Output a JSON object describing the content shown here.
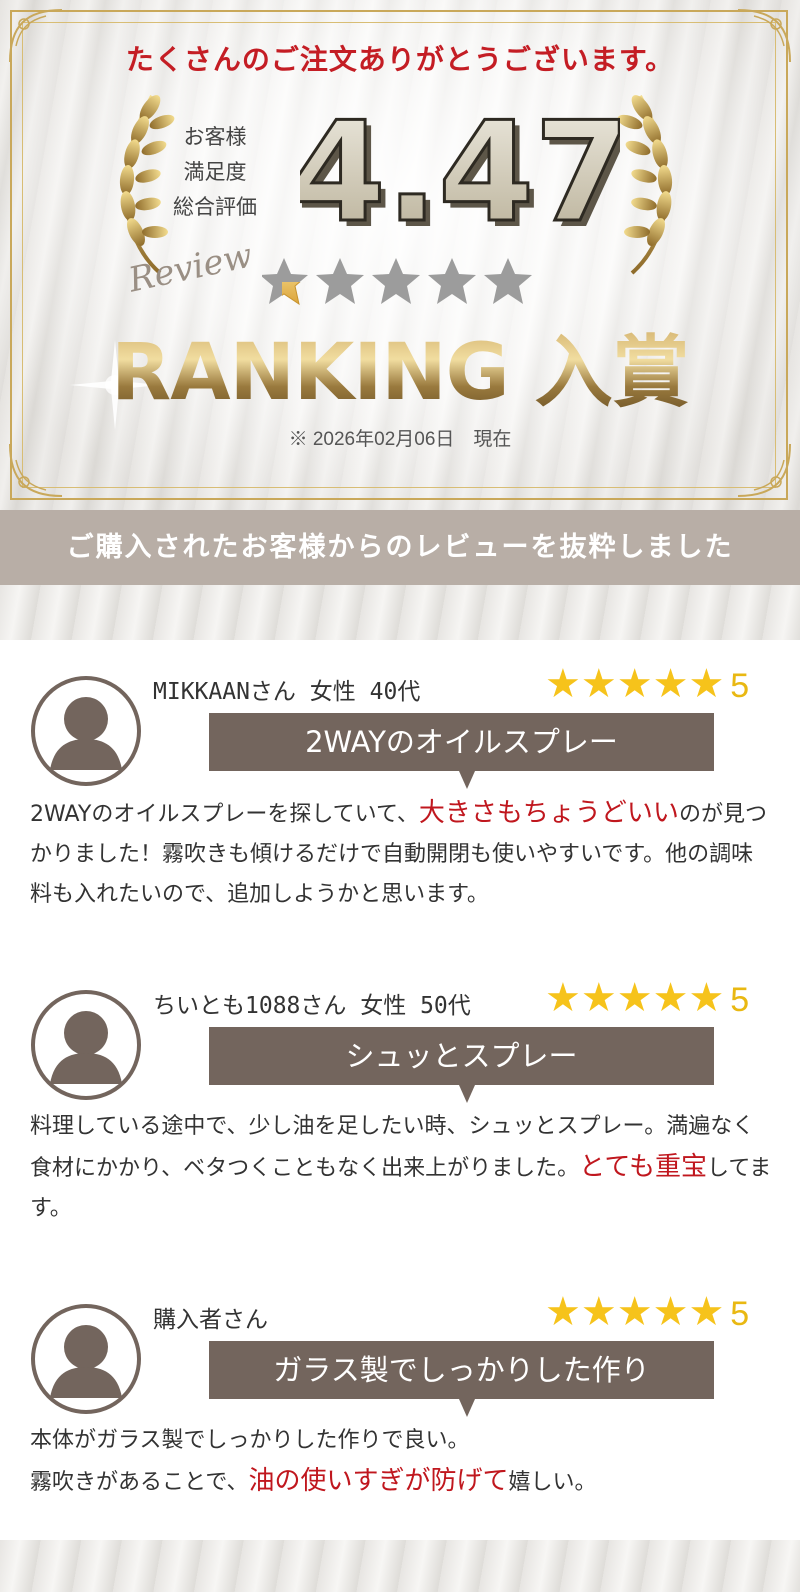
{
  "hero": {
    "title": "たくさんのご注文ありがとうございます。",
    "label_lines": [
      "お客様",
      "満足度",
      "総合評価"
    ],
    "score": "4.47",
    "score_value": 4.47,
    "script_word": "Review",
    "ranking": "RANKING 入賞",
    "as_of": "※ 2026年02月06日　現在",
    "accent_color": "#c41d24",
    "gold_color": "#c9a85a"
  },
  "band": {
    "text": "ご購入されたお客様からのレビューを抜粋しました",
    "color": "#b8aea6"
  },
  "reviews": [
    {
      "reviewer": "MIKKAANさん 女性 40代",
      "stars": "★★★★★",
      "rating": "5",
      "headline": "2WAYのオイルスプレー",
      "body_before": "2WAYのオイルスプレーを探していて、",
      "body_highlight": "大きさもちょうどいい",
      "body_after": "のが見つかりました！霧吹きも傾けるだけで自動開閉も使いやすいです。他の調味料も入れたいので、追加しようかと思います。"
    },
    {
      "reviewer": "ちいとも1088さん 女性 50代",
      "stars": "★★★★★",
      "rating": "5",
      "headline": "シュッとスプレー",
      "body_before": "料理している途中で、少し油を足したい時、シュッとスプレー。満遍なく食材にかかり、ベタつくこともなく出来上がりました。",
      "body_highlight": "とても重宝",
      "body_after": "してます。"
    },
    {
      "reviewer": "購入者さん",
      "stars": "★★★★★",
      "rating": "5",
      "headline": "ガラス製でしっかりした作り",
      "body_before": "本体がガラス製でしっかりした作りで良い。\n霧吹きがあることで、",
      "body_highlight": "油の使いすぎが防げて",
      "body_after": "嬉しい。"
    }
  ],
  "icons": {
    "avatar": "user-avatar-icon",
    "star": "star-icon",
    "laurel": "laurel-icon"
  }
}
